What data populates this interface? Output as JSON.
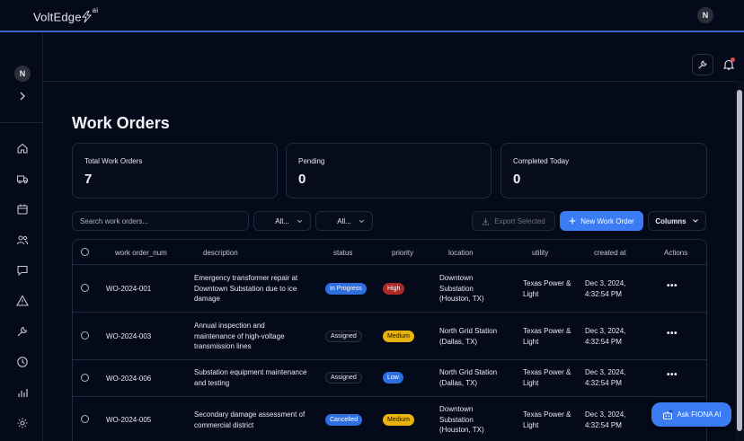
{
  "app": {
    "brand": "VoltEdge",
    "brand_suffix": "ai",
    "user_initial": "N"
  },
  "sidebar": {
    "user_initial": "N",
    "items": [
      {
        "icon": "home-icon"
      },
      {
        "icon": "truck-icon"
      },
      {
        "icon": "calendar-icon"
      },
      {
        "icon": "users-icon"
      },
      {
        "icon": "chat-icon"
      },
      {
        "icon": "warning-icon"
      },
      {
        "icon": "wrench-icon"
      },
      {
        "icon": "clock-icon"
      },
      {
        "icon": "bar-chart-icon"
      },
      {
        "icon": "gear-icon"
      }
    ]
  },
  "page": {
    "title": "Work Orders"
  },
  "stats": [
    {
      "label": "Total Work Orders",
      "value": "7"
    },
    {
      "label": "Pending",
      "value": "0"
    },
    {
      "label": "Completed Today",
      "value": "0"
    }
  ],
  "toolbar": {
    "search_placeholder": "Search work orders...",
    "filter1": "All...",
    "filter2": "All...",
    "export_label": "Export Selected",
    "new_label": "New Work Order",
    "columns_label": "Columns"
  },
  "table": {
    "headers": {
      "num": "work order_num",
      "description": "description",
      "status": "status",
      "priority": "priority",
      "location": "location",
      "utility": "utility",
      "created": "created at",
      "actions": "Actions"
    },
    "rows": [
      {
        "num": "WO-2024-001",
        "description": "Emergency transformer repair at Downtown Substation due to ice damage",
        "status": "In Progress",
        "priority": "High",
        "location": "Downtown Substation (Houston, TX)",
        "utility": "Texas Power & Light",
        "created": "Dec 3, 2024, 4:32:54 PM",
        "actions": "•••"
      },
      {
        "num": "WO-2024-003",
        "description": "Annual inspection and maintenance of high-voltage transmission lines",
        "status": "Assigned",
        "priority": "Medium",
        "location": "North Grid Station (Dallas, TX)",
        "utility": "Texas Power & Light",
        "created": "Dec 3, 2024, 4:32:54 PM",
        "actions": "•••"
      },
      {
        "num": "WO-2024-006",
        "description": "Substation equipment maintenance and testing",
        "status": "Assigned",
        "priority": "Low",
        "location": "North Grid Station (Dallas, TX)",
        "utility": "Texas Power & Light",
        "created": "Dec 3, 2024, 4:32:54 PM",
        "actions": "•••"
      },
      {
        "num": "WO-2024-005",
        "description": "Secondary damage assessment of commercial district",
        "status": "Cancelled",
        "priority": "Medium",
        "location": "Downtown Substation (Houston, TX)",
        "utility": "Texas Power & Light",
        "created": "Dec 3, 2024, 4:32:54 PM",
        "actions": "•••"
      }
    ]
  },
  "assistant": {
    "label": "Ask FIONA AI"
  },
  "colors": {
    "accent": "#3b7cf5",
    "background": "#050a1a",
    "high": "#b02929",
    "medium": "#e8b30d"
  }
}
